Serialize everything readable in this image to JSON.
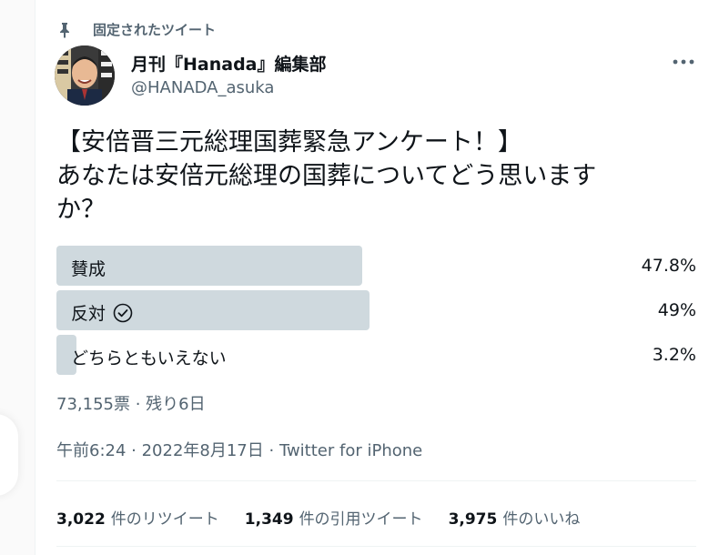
{
  "pinned_label": "固定されたツイート",
  "author": {
    "name": "月刊『Hanada』編集部",
    "handle": "@HANADA_asuka"
  },
  "tweet_text": "【安倍晋三元総理国葬緊急アンケート！】\nあなたは安倍元総理の国葬についてどう思います\nか？",
  "poll": {
    "options": [
      {
        "label": "賛成",
        "percent_text": "47.8%",
        "fraction": 0.478,
        "selected": false
      },
      {
        "label": "反対",
        "percent_text": "49%",
        "fraction": 0.49,
        "selected": true
      },
      {
        "label": "どちらともいえない",
        "percent_text": "3.2%",
        "fraction": 0.032,
        "selected": false
      }
    ],
    "meta": "73,155票 · 残り6日"
  },
  "timestamp": {
    "time": "午前6:24",
    "separator": " · ",
    "date": "2022年8月17日",
    "source": "Twitter for iPhone"
  },
  "stats": {
    "retweets": {
      "count": "3,022",
      "label": "件のリツイート"
    },
    "quotes": {
      "count": "1,349",
      "label": "件の引用ツイート"
    },
    "likes": {
      "count": "3,975",
      "label": "件のいいね"
    }
  },
  "colors": {
    "bar": "#cfd9de",
    "secondary_text": "#536471",
    "primary_text": "#0f1419"
  }
}
